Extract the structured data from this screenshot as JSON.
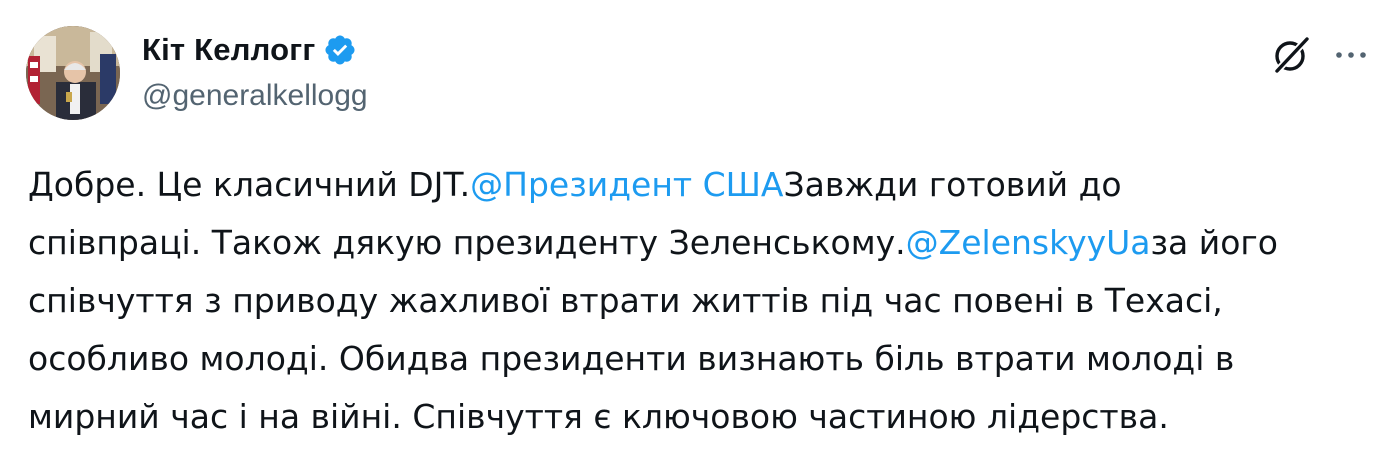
{
  "author": {
    "display_name": "Кіт Келлогг",
    "handle": "@generalkellogg",
    "verified": true,
    "verified_icon": "verified-badge-icon",
    "avatar_icon": "profile-photo"
  },
  "actions": {
    "grok_icon": "grok-icon",
    "more_icon": "more-icon"
  },
  "colors": {
    "text": "#0f1419",
    "secondary": "#536471",
    "link": "#1d9bf0"
  },
  "tweet": {
    "line1": {
      "a": "Добре. Це класичний DJT.",
      "mention1": "@Президент США",
      "b": "Завжди готовий до"
    },
    "line2": {
      "a": "співпраці. Також дякую президенту Зеленському.",
      "mention2": "@ZelenskyyUa",
      "b": "за його"
    },
    "line3": "співчуття з приводу жахливої втрати життів під час повені в Техасі,",
    "line4": "особливо молоді. Обидва президенти визнають біль втрати молоді в",
    "line5": "мирний час і на війні. Співчуття є ключовою частиною лідерства."
  }
}
